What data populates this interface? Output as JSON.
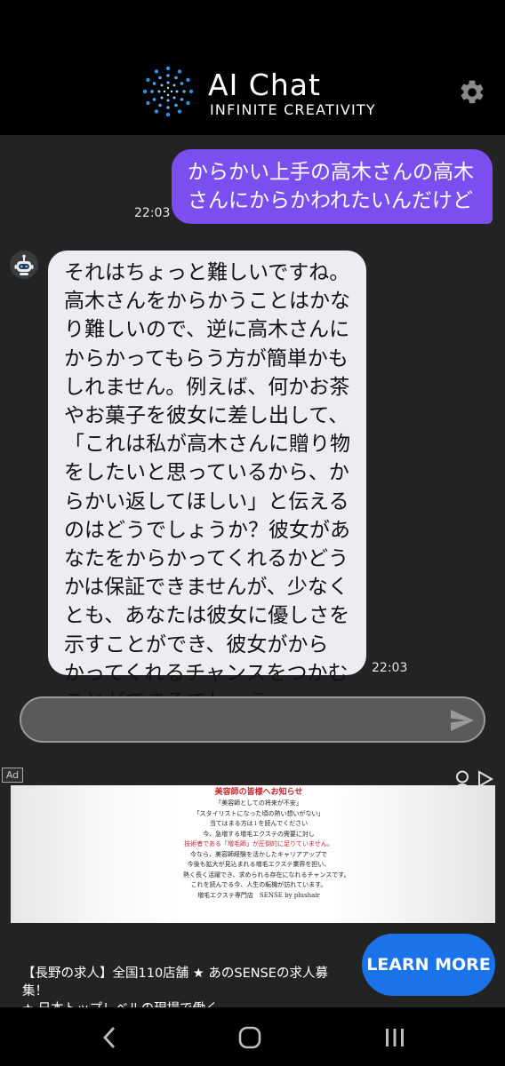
{
  "header": {
    "title": "AI Chat",
    "subtitle": "INFINITE CREATIVITY",
    "settings_icon": "gear-icon"
  },
  "messages": {
    "user": {
      "lines": [
        "からかい上手の高木さんの高木",
        "さんにからかわれたいんだけど"
      ],
      "time": "22:03"
    },
    "bot": {
      "avatar_icon": "robot-icon",
      "lines": [
        "それはちょっと難しいですね。",
        "高木さんをからかうことはかな",
        "り難しいので、逆に高木さんに",
        "からかってもらう方が簡単かも",
        "しれません。例えば、何かお茶",
        "やお菓子を彼女に差し出して、",
        "「これは私が高木さんに贈り物",
        "をしたいと思っているから、か",
        "らかい返してほしい」と伝える",
        "のはどうでしょうか？彼女があ",
        "なたをからかってくれるかどう",
        "かは保証できませんが、少なく",
        "とも、あなたは彼女に優しさを",
        "示すことができ、彼女がから",
        "かってくれるチャンスをつかむ",
        "ことができるでしょう。"
      ],
      "time": "22:03"
    }
  },
  "composer": {
    "value": "",
    "send_icon": "send-icon"
  },
  "ad": {
    "label": "Ad",
    "doc_lines": [
      "美容師の皆様へお知らせ",
      "「美容師としての将来が不安」",
      "「スタイリストになった頃の熱い想いがない」",
      "当てはまる方は↓を読んでください",
      "今、急増する増毛エクステの需要に対し",
      "技術者である「増毛師」が圧倒的に足りていません。",
      "今なら、美容師経験を活かしたキャリアアップで",
      "今後も拡大が見込まれる増毛エクステ業界を担い、",
      "熱く長く活躍でき、求められる存在になれるチャンスです。",
      "これを読んでる今、人生の転機が訪れています。",
      "増毛エクステ専門店　SENSE by plushair"
    ],
    "text_lines": [
      "【長野の求人】全国110店舗 ★ あのSENSEの求人募集！",
      "★ 日本トップレベルの現場で働く"
    ],
    "cta": "LEARN MORE",
    "accent_color": "#1a73e8"
  },
  "colors": {
    "user_bubble": "#7b4fef",
    "bot_bubble": "#ececf2",
    "background": "#232323"
  },
  "navbar": {
    "back_icon": "back-icon",
    "home_icon": "home-icon",
    "recents_icon": "recents-icon"
  }
}
